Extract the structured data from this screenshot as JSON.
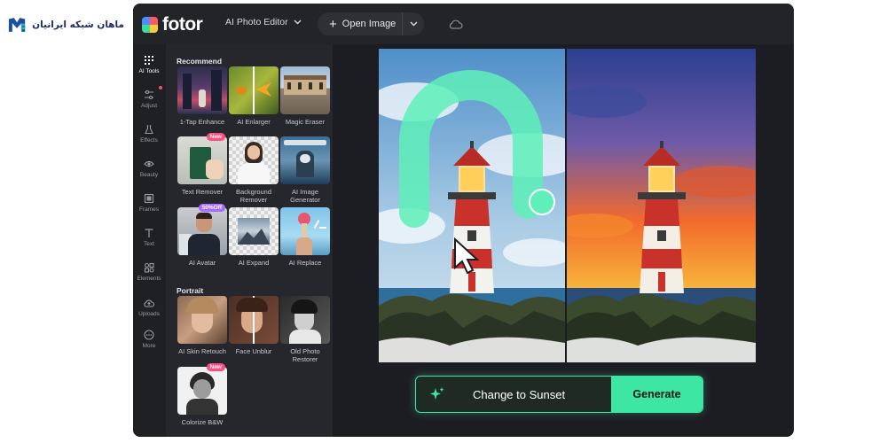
{
  "watermark": {
    "text": "ماهان شبکه ایرانیان"
  },
  "app": {
    "brand": "fotor",
    "editor_menu": "AI Photo Editor",
    "open_image": "Open Image"
  },
  "rail": {
    "items": [
      {
        "label": "AI Tools",
        "icon": "grid-icon"
      },
      {
        "label": "Adjust",
        "icon": "sliders-icon"
      },
      {
        "label": "Effects",
        "icon": "flask-icon"
      },
      {
        "label": "Beauty",
        "icon": "eye-icon"
      },
      {
        "label": "Frames",
        "icon": "frame-icon"
      },
      {
        "label": "Text",
        "icon": "text-icon"
      },
      {
        "label": "Elements",
        "icon": "shapes-icon"
      },
      {
        "label": "Uploads",
        "icon": "upload-icon"
      },
      {
        "label": "More",
        "icon": "more-icon"
      }
    ]
  },
  "panel": {
    "recommend_title": "Recommend",
    "portrait_title": "Portrait",
    "recommend": [
      {
        "label": "1-Tap Enhance"
      },
      {
        "label": "AI Enlarger"
      },
      {
        "label": "Magic Eraser"
      },
      {
        "label": "Text Remover",
        "badge": "New"
      },
      {
        "label": "Background Remover"
      },
      {
        "label": "AI Image Generator"
      },
      {
        "label": "AI Avatar",
        "badge": "50%Off"
      },
      {
        "label": "AI Expand"
      },
      {
        "label": "AI Replace"
      }
    ],
    "portrait": [
      {
        "label": "AI Skin Retouch"
      },
      {
        "label": "Face Unblur"
      },
      {
        "label": "Old Photo Restorer"
      },
      {
        "label": "Colorize B&W",
        "badge": "New"
      }
    ]
  },
  "prompt": {
    "text": "Change to Sunset",
    "button": "Generate"
  },
  "colors": {
    "accent": "#3ee6a3",
    "window_bg": "#1c1d22",
    "panel_bg": "#26272c",
    "new_badge": "#ff4d7e",
    "off_badge": "#a66bff"
  }
}
